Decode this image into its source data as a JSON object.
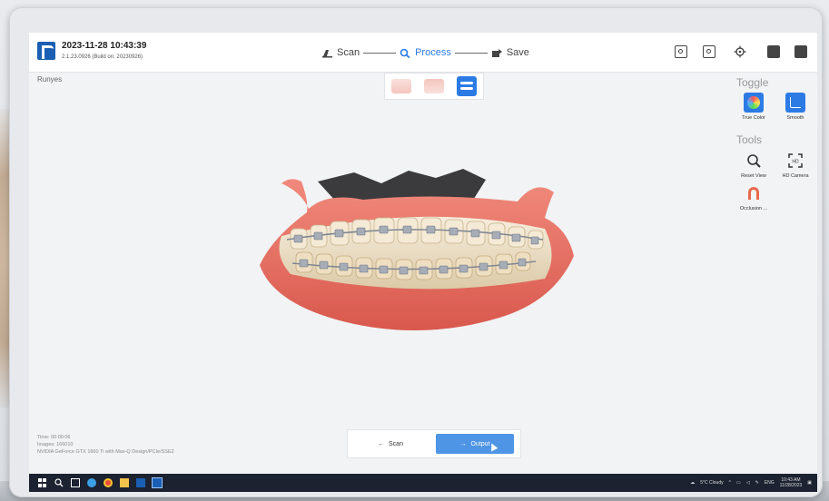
{
  "header": {
    "datetime": "2023-11-28 10:43:39",
    "version": "2.1.23.0926 (Build on: 20230926)"
  },
  "steps": [
    {
      "label": "Scan",
      "icon": "scanner-icon",
      "active": false
    },
    {
      "label": "Process",
      "icon": "magnifier-icon",
      "active": true
    },
    {
      "label": "Save",
      "icon": "save-icon",
      "active": false
    }
  ],
  "brand_label": "Runyes",
  "right_panel": {
    "toggle_title": "Toggle",
    "toggle_items": [
      "True Color",
      "Smooth"
    ],
    "tools_title": "Tools",
    "tool_items": [
      "Reset View",
      "HD Camera",
      "Occlusion ..."
    ]
  },
  "bottom_info": {
    "time": "Time: 00:00:06",
    "images": "Images: 166010",
    "gpu": "NVIDIA GeForce GTX 1660 Ti with Max-Q Design/PCIe/SSE2"
  },
  "bottom_bar": {
    "scan_label": "Scan",
    "output_label": "Output"
  },
  "taskbar": {
    "weather": "5°C Cloudy",
    "lang": "ENG",
    "time": "10:43 AM",
    "date": "11/28/2023"
  },
  "colors": {
    "accent": "#2c7be5",
    "output_button": "#4f95e6",
    "taskbar": "#1c2230",
    "gum": "#e86a5c"
  }
}
